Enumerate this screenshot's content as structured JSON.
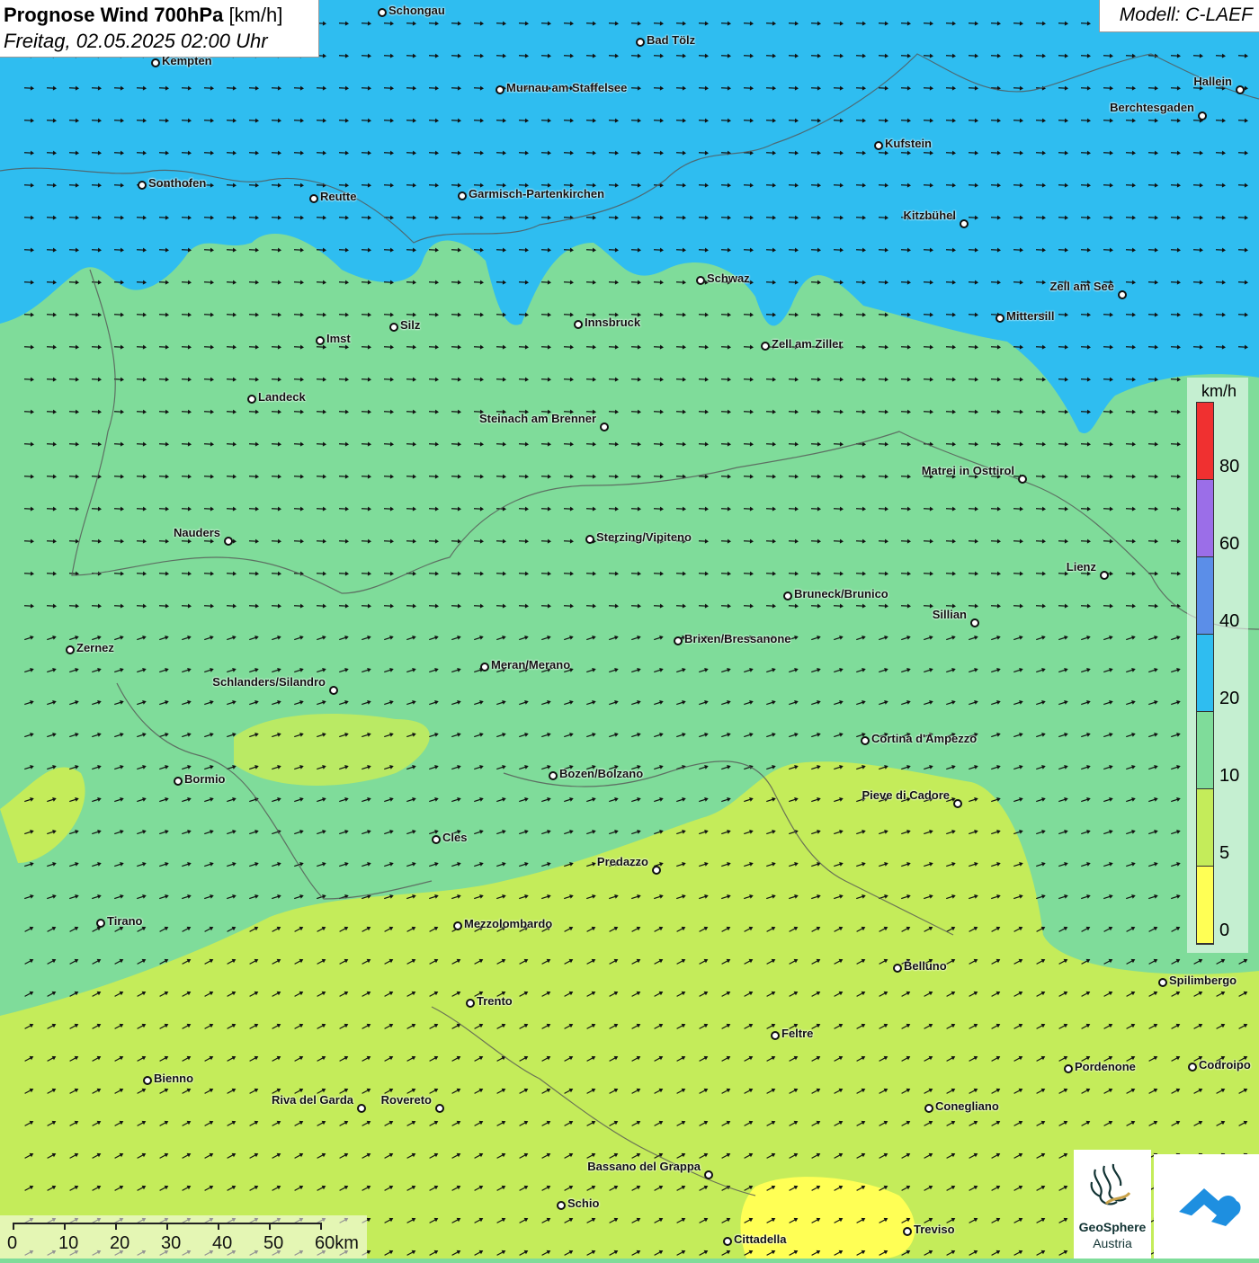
{
  "title": {
    "main": "Prognose Wind 700hPa",
    "unit": "[km/h]",
    "date": "Freitag, 02.05.2025 02:00 Uhr"
  },
  "model": "Modell: C-LAEF",
  "legend": {
    "unit": "km/h",
    "ticks": [
      "80",
      "60",
      "40",
      "20",
      "10",
      "5",
      "0"
    ],
    "colors": [
      "#f03030",
      "#9b6ee8",
      "#5b8ee8",
      "#2fbdf0",
      "#7fdc9a",
      "#c4ec5a",
      "#ffff55"
    ]
  },
  "cities": [
    {
      "name": "Schongau"
    },
    {
      "name": "Bad Tölz"
    },
    {
      "name": "Kempten"
    },
    {
      "name": "Murnau am Staffelsee"
    },
    {
      "name": "Hallein"
    },
    {
      "name": "Berchtesgaden"
    },
    {
      "name": "Kufstein"
    },
    {
      "name": "Sonthofen"
    },
    {
      "name": "Reutte"
    },
    {
      "name": "Garmisch-Partenkirchen"
    },
    {
      "name": "Kitzbühel"
    },
    {
      "name": "Schwaz"
    },
    {
      "name": "Zell am See"
    },
    {
      "name": "Mittersill"
    },
    {
      "name": "Innsbruck"
    },
    {
      "name": "Silz"
    },
    {
      "name": "Imst"
    },
    {
      "name": "Zell am Ziller"
    },
    {
      "name": "Landeck"
    },
    {
      "name": "Steinach am Brenner"
    },
    {
      "name": "Matrei in Osttirol"
    },
    {
      "name": "Nauders"
    },
    {
      "name": "Sterzing/Vipiteno"
    },
    {
      "name": "Lienz"
    },
    {
      "name": "Bruneck/Brunico"
    },
    {
      "name": "Sillian"
    },
    {
      "name": "Brixen/Bressanone"
    },
    {
      "name": "Zernez"
    },
    {
      "name": "Meran/Merano"
    },
    {
      "name": "Schlanders/Silandro"
    },
    {
      "name": "Cortina d'Ampezzo"
    },
    {
      "name": "Bozen/Bolzano"
    },
    {
      "name": "Bormio"
    },
    {
      "name": "Pieve di Cadore"
    },
    {
      "name": "Cles"
    },
    {
      "name": "Predazzo"
    },
    {
      "name": "Tirano"
    },
    {
      "name": "Mezzolombardo"
    },
    {
      "name": "Belluno"
    },
    {
      "name": "Spilimbergo"
    },
    {
      "name": "Trento"
    },
    {
      "name": "Feltre"
    },
    {
      "name": "Pordenone"
    },
    {
      "name": "Codroipo"
    },
    {
      "name": "Bienno"
    },
    {
      "name": "Riva del Garda"
    },
    {
      "name": "Rovereto"
    },
    {
      "name": "Conegliano"
    },
    {
      "name": "Bassano del Grappa"
    },
    {
      "name": "Schio"
    },
    {
      "name": "Treviso"
    },
    {
      "name": "Cittadella"
    }
  ],
  "scale": {
    "labels": [
      "0",
      "10",
      "20",
      "30",
      "40",
      "50",
      "60km"
    ]
  },
  "logos": {
    "geo_line1": "GeoSphere",
    "geo_line2": "Austria"
  }
}
